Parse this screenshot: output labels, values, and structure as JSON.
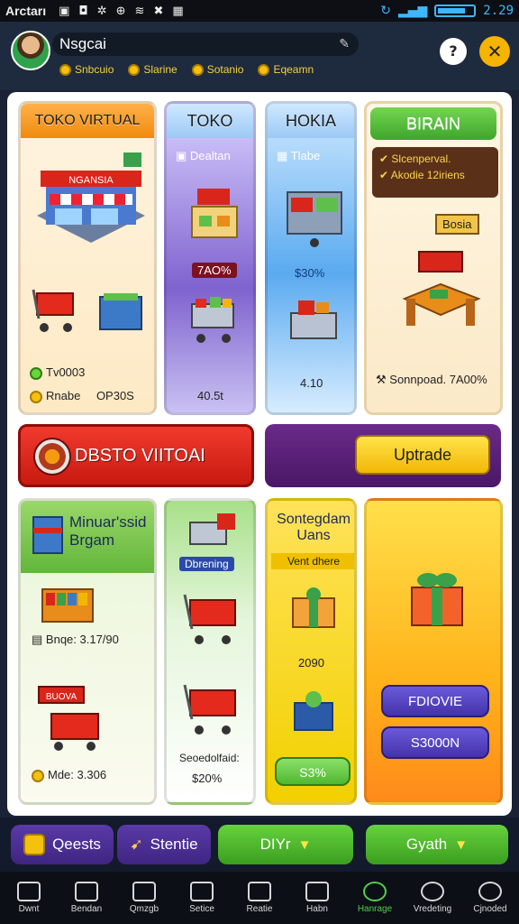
{
  "status_bar": {
    "carrier": "Arctarı",
    "time": "2.29"
  },
  "header": {
    "player_name": "Nsgcai",
    "stats": [
      "Snbcuio",
      "Slarine",
      "Sotanio",
      "Eqeamn"
    ],
    "help_label": "?",
    "close_label": "✕"
  },
  "cards": {
    "toko_virtual": {
      "title": "TOKO VIRTUAL",
      "sign": "NGANSIA",
      "line1": "Tv0003",
      "line2_label": "Rnabe",
      "line2_value": "OP30S"
    },
    "toko": {
      "title": "TOKO",
      "subtitle": "Dealtan",
      "price_tag": "7AO%",
      "value": "40.5t"
    },
    "horia": {
      "title": "HOKIA",
      "subtitle": "Tlabe",
      "percent": "$30%",
      "value": "4.10"
    },
    "birain": {
      "title": "BIRAIN",
      "check1": "Slcenperval.",
      "check2": "Akodie 12iriens",
      "sign": "Bosia",
      "footer": "Sonnpoad. 7A00%"
    },
    "minuarssid": {
      "title_line1": "Minuar'ssid",
      "title_line2": "Brgam",
      "line1": "Bnqe: 3.17/90",
      "sign": "BUOVA",
      "line2": "Mde: 3.306"
    },
    "dbrening": {
      "tag": "Dbrening",
      "caption": "Seoedolfaid:",
      "value": "$20%"
    },
    "santegdam": {
      "title_line1": "Sontegdam",
      "title_line2": "Uans",
      "subtitle": "Vent dhere",
      "value": "2090",
      "button": "S3%"
    },
    "gift": {
      "btn1": "FDIOVIE",
      "btn2": "S3000N"
    }
  },
  "banners": {
    "red": "DBSTO VIITOAI",
    "upgrade": "Uptrade"
  },
  "action_bar": {
    "quests": "Qeests",
    "storie": "Stentie",
    "diy": "DIYr",
    "gyath": "Gyath"
  },
  "nav": [
    {
      "label": "Dwnt"
    },
    {
      "label": "Bendan"
    },
    {
      "label": "Qmzgb"
    },
    {
      "label": "Setice"
    },
    {
      "label": "Reatie"
    },
    {
      "label": "Habn"
    },
    {
      "label": "Hanrage"
    },
    {
      "label": "Vredeting"
    },
    {
      "label": "Cjnoded"
    }
  ],
  "colors": {
    "accent_green": "#4fd14a",
    "accent_yellow": "#f2b705",
    "accent_red": "#e0271b",
    "accent_purple": "#4a1766"
  }
}
